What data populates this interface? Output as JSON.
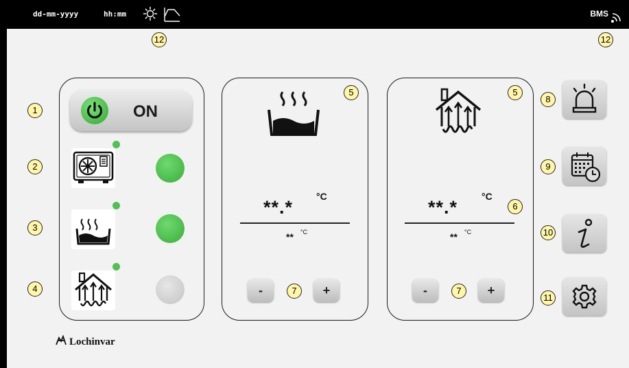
{
  "topbar": {
    "date_format": "dd-mm-yyyy",
    "time_format": "hh:mm",
    "status_icons": [
      "sun-icon",
      "curve-icon"
    ],
    "bms_label": "BMS",
    "bms_icon": "wireless-signal-icon"
  },
  "callouts": [
    "1",
    "2",
    "3",
    "4",
    "5",
    "6",
    "7",
    "8",
    "9",
    "10",
    "11",
    "12"
  ],
  "left_panel": {
    "power_button": {
      "label": "ON",
      "state": "on"
    },
    "rows": [
      {
        "icon": "heat-pump-unit-icon",
        "lamp_state": "on",
        "lamp_color": "#4cbb4c"
      },
      {
        "icon": "hot-water-tank-icon",
        "lamp_state": "on",
        "lamp_color": "#4cbb4c"
      },
      {
        "icon": "home-heating-icon",
        "lamp_state": "off",
        "lamp_color": "#cfcfcf"
      }
    ]
  },
  "dhw_panel": {
    "icon": "hot-water-tank-icon",
    "actual_temp": "**.*",
    "actual_unit": "°C",
    "setpoint": "**",
    "setpoint_unit": "°C",
    "minus_label": "-",
    "plus_label": "+"
  },
  "heating_panel": {
    "icon": "home-heating-icon",
    "actual_temp": "**.*",
    "actual_unit": "°C",
    "setpoint": "**",
    "setpoint_unit": "°C",
    "minus_label": "-",
    "plus_label": "+"
  },
  "side_buttons": [
    {
      "icon": "alarm-bell-icon"
    },
    {
      "icon": "calendar-schedule-icon"
    },
    {
      "icon": "info-icon"
    },
    {
      "icon": "settings-gear-icon"
    }
  ],
  "brand": {
    "name": "Lochinvar",
    "logo": "lochinvar-logo"
  },
  "colors": {
    "accent_green": "#4cbb4c",
    "topbar": "#000000",
    "background": "#f2f2f2",
    "callout_fill": "#fff6a8"
  }
}
